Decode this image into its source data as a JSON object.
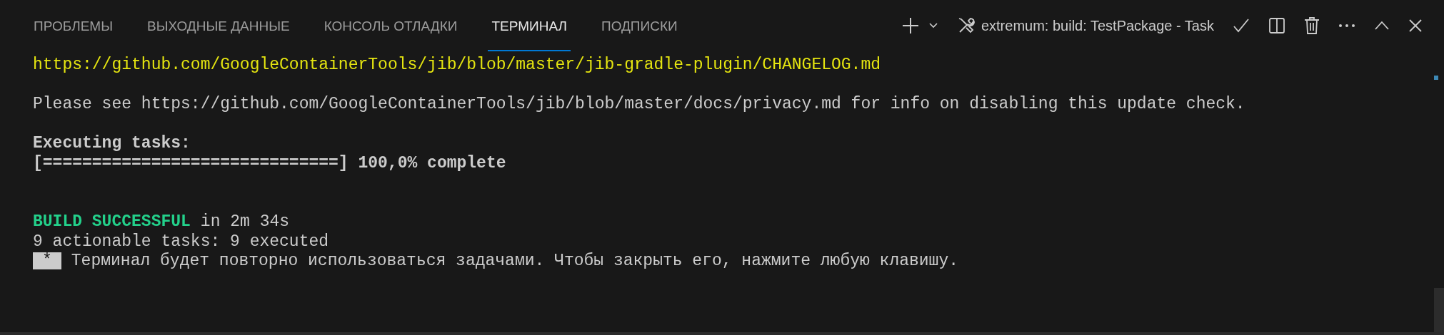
{
  "tabs": [
    {
      "label": "ПРОБЛЕМЫ",
      "selected": false
    },
    {
      "label": "ВЫХОДНЫЕ ДАННЫЕ",
      "selected": false
    },
    {
      "label": "КОНСОЛЬ ОТЛАДКИ",
      "selected": false
    },
    {
      "label": "ТЕРМИНАЛ",
      "selected": true
    },
    {
      "label": "ПОДПИСКИ",
      "selected": false
    }
  ],
  "terminal_task": {
    "title": "extremum: build: TestPackage - Task"
  },
  "lines": [
    {
      "kind": "link",
      "text": "https://github.com/GoogleContainerTools/jib/blob/master/jib-gradle-plugin/CHANGELOG.md"
    },
    {
      "kind": "blank"
    },
    {
      "kind": "plain",
      "text": "Please see https://github.com/GoogleContainerTools/jib/blob/master/docs/privacy.md for info on disabling this update check."
    },
    {
      "kind": "blank"
    },
    {
      "kind": "bold",
      "text": "Executing tasks:"
    },
    {
      "kind": "bold",
      "text": "[==============================] 100,0% complete"
    },
    {
      "kind": "blank"
    },
    {
      "kind": "blank"
    },
    {
      "kind": "result",
      "status": "BUILD SUCCESSFUL",
      "text": "in 2m 34s"
    },
    {
      "kind": "plain",
      "text": "9 actionable tasks: 9 executed"
    },
    {
      "kind": "prompt",
      "marker": "*",
      "text": "Терминал будет повторно использоваться задачами. Чтобы закрыть его, нажмите любую клавишу."
    }
  ]
}
